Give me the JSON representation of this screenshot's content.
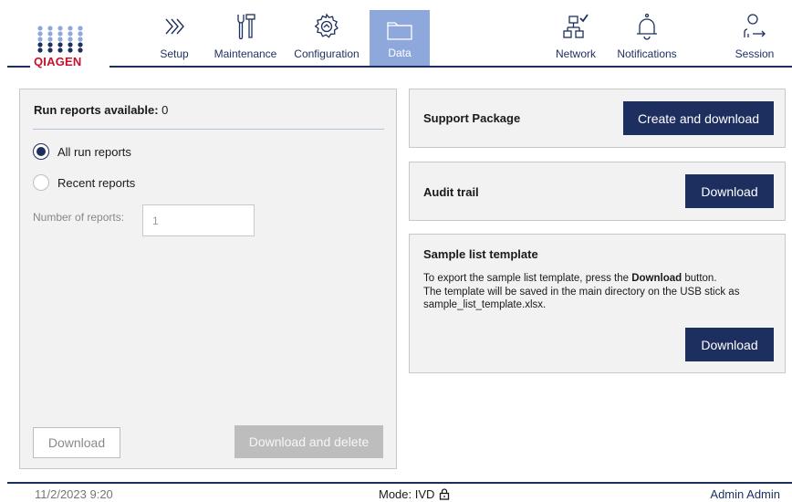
{
  "brand": {
    "logo_text": "QIAGEN",
    "color": "#c8102e",
    "dot_color": "#8fa8dc",
    "navy": "#1d2f5f"
  },
  "nav": {
    "items": [
      {
        "label": "Setup",
        "icon": "chevrons-right-icon"
      },
      {
        "label": "Maintenance",
        "icon": "tools-icon"
      },
      {
        "label": "Configuration",
        "icon": "gear-icon"
      },
      {
        "label": "Data",
        "icon": "folder-icon",
        "active": true
      },
      {
        "label": "Network",
        "icon": "network-icon"
      },
      {
        "label": "Notifications",
        "icon": "bell-icon"
      },
      {
        "label": "Session",
        "icon": "user-logout-icon"
      }
    ]
  },
  "run_reports": {
    "title_label": "Run reports available:",
    "title_value": "0",
    "options": [
      {
        "label": "All run reports",
        "selected": true
      },
      {
        "label": "Recent reports",
        "selected": false
      }
    ],
    "number_label": "Number of reports:",
    "number_value": "1",
    "download_label": "Download",
    "download_delete_label": "Download and delete"
  },
  "support_package": {
    "title": "Support Package",
    "button_label": "Create and download"
  },
  "audit_trail": {
    "title": "Audit trail",
    "button_label": "Download"
  },
  "sample_list_template": {
    "title": "Sample list template",
    "text_prefix": "To export the sample list template, press the ",
    "text_bold": "Download",
    "text_suffix": " button.",
    "text_line2": "The template will be saved in the main directory on the USB stick as",
    "text_line3": "sample_list_template.xlsx.",
    "button_label": "Download"
  },
  "footer": {
    "datetime": "11/2/2023 9:20",
    "mode": "Mode: IVD",
    "mode_icon": "lock-icon",
    "user": "Admin Admin"
  }
}
